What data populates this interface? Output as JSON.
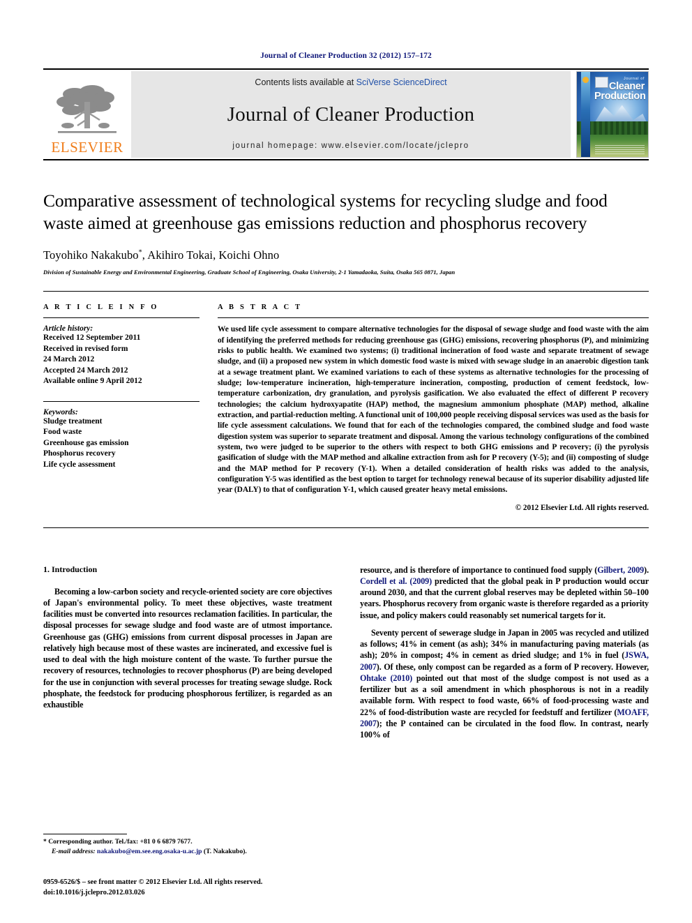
{
  "running_head": "Journal of Cleaner Production 32 (2012) 157–172",
  "masthead": {
    "publisher": "ELSEVIER",
    "contents_prefix": "Contents lists available at ",
    "contents_link": "SciVerse ScienceDirect",
    "journal_title": "Journal of Cleaner Production",
    "homepage": "journal homepage: www.elsevier.com/locate/jclepro",
    "cover": {
      "line_small": "Journal of",
      "line_big_1": "Cleaner",
      "line_big_2": "Production"
    }
  },
  "article": {
    "title": "Comparative assessment of technological systems for recycling sludge and food waste aimed at greenhouse gas emissions reduction and phosphorus recovery",
    "authors": "Toyohiko Nakakubo",
    "authors_rest": ", Akihiro Tokai, Koichi Ohno",
    "corresponding_mark": "*",
    "affiliation": "Division of Sustainable Energy and Environmental Engineering, Graduate School of Engineering, Osaka University, 2-1 Yamadaoka, Suita, Osaka 565 0871, Japan"
  },
  "article_info": {
    "heading": "A R T I C L E   I N F O",
    "history_label": "Article history:",
    "history": [
      "Received 12 September 2011",
      "Received in revised form",
      "24 March 2012",
      "Accepted 24 March 2012",
      "Available online 9 April 2012"
    ],
    "keywords_label": "Keywords:",
    "keywords": [
      "Sludge treatment",
      "Food waste",
      "Greenhouse gas emission",
      "Phosphorus recovery",
      "Life cycle assessment"
    ]
  },
  "abstract": {
    "heading": "A B S T R A C T",
    "text": "We used life cycle assessment to compare alternative technologies for the disposal of sewage sludge and food waste with the aim of identifying the preferred methods for reducing greenhouse gas (GHG) emissions, recovering phosphorus (P), and minimizing risks to public health. We examined two systems; (i) traditional incineration of food waste and separate treatment of sewage sludge, and (ii) a proposed new system in which domestic food waste is mixed with sewage sludge in an anaerobic digestion tank at a sewage treatment plant. We examined variations to each of these systems as alternative technologies for the processing of sludge; low-temperature incineration, high-temperature incineration, composting, production of cement feedstock, low-temperature carbonization, dry granulation, and pyrolysis gasification. We also evaluated the effect of different P recovery technologies; the calcium hydroxyapatite (HAP) method, the magnesium ammonium phosphate (MAP) method, alkaline extraction, and partial-reduction melting. A functional unit of 100,000 people receiving disposal services was used as the basis for life cycle assessment calculations. We found that for each of the technologies compared, the combined sludge and food waste digestion system was superior to separate treatment and disposal. Among the various technology configurations of the combined system, two were judged to be superior to the others with respect to both GHG emissions and P recovery; (i) the pyrolysis gasification of sludge with the MAP method and alkaline extraction from ash for P recovery (Y-5); and (ii) composting of sludge and the MAP method for P recovery (Y-1). When a detailed consideration of health risks was added to the analysis, configuration Y-5 was identified as the best option to target for technology renewal because of its superior disability adjusted life year (DALY) to that of configuration Y-1, which caused greater heavy metal emissions.",
    "copyright": "© 2012 Elsevier Ltd. All rights reserved."
  },
  "introduction": {
    "heading": "1.  Introduction",
    "left_p1": "Becoming a low-carbon society and recycle-oriented society are core objectives of Japan's environmental policy. To meet these objectives, waste treatment facilities must be converted into resources reclamation facilities. In particular, the disposal processes for sewage sludge and food waste are of utmost importance. Greenhouse gas (GHG) emissions from current disposal processes in Japan are relatively high because most of these wastes are incinerated, and excessive fuel is used to deal with the high moisture content of the waste. To further pursue the recovery of resources, technologies to recover phosphorus (P) are being developed for the use in conjunction with several processes for treating sewage sludge. Rock phosphate, the feedstock for producing phosphorous fertilizer, is regarded as an exhaustible",
    "right_p1_a": "resource, and is therefore of importance to continued food supply (",
    "right_cite_1": "Gilbert, 2009",
    "right_p1_b": "). ",
    "right_cite_2": "Cordell et al. (2009)",
    "right_p1_c": " predicted that the global peak in P production would occur around 2030, and that the current global reserves may be depleted within 50–100 years. Phosphorus recovery from organic waste is therefore regarded as a priority issue, and policy makers could reasonably set numerical targets for it.",
    "right_p2_a": "Seventy percent of sewerage sludge in Japan in 2005 was recycled and utilized as follows; 41% in cement (as ash); 34% in manufacturing paving materials (as ash); 20% in compost; 4% in cement as dried sludge; and 1% in fuel (",
    "right_cite_3": "JSWA, 2007",
    "right_p2_b": "). Of these, only compost can be regarded as a form of P recovery. However, ",
    "right_cite_4": "Ohtake (2010)",
    "right_p2_c": " pointed out that most of the sludge compost is not used as a fertilizer but as a soil amendment in which phosphorous is not in a readily available form. With respect to food waste, 66% of food-processing waste and 22% of food-distribution waste are recycled for feedstuff and fertilizer (",
    "right_cite_5": "MOAFF, 2007",
    "right_p2_d": "); the P contained can be circulated in the food flow. In contrast, nearly 100% of"
  },
  "footnotes": {
    "corresponding": "* Corresponding author. Tel./fax: +81 0 6 6879 7677.",
    "email_label": "E-mail address:",
    "email": "nakakubo@em.see.eng.osaka-u.ac.jp",
    "email_suffix": " (T. Nakakubo).",
    "frontmatter": "0959-6526/$ – see front matter © 2012 Elsevier Ltd. All rights reserved.",
    "doi": "doi:10.1016/j.jclepro.2012.03.026"
  },
  "colors": {
    "link_blue": "#10187a",
    "sciencedirect_blue": "#1f4fa8",
    "elsevier_orange": "#f07d1a",
    "banner_gray": "#e6e6e6"
  }
}
